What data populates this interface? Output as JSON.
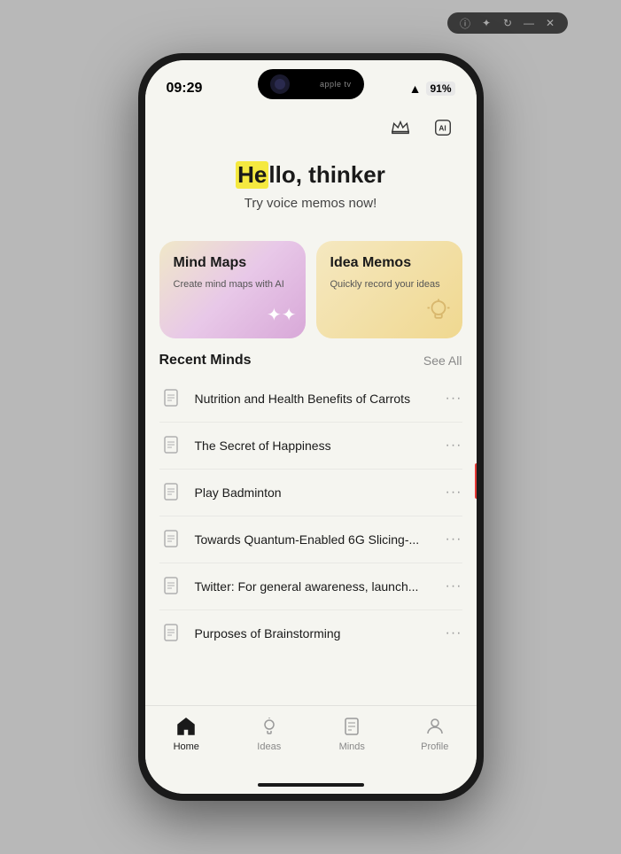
{
  "browser": {
    "icons": [
      "info",
      "star",
      "refresh",
      "minimize",
      "close"
    ]
  },
  "status_bar": {
    "time": "09:29",
    "wifi": "WiFi",
    "battery": "91%",
    "dynamic_island_label": "apple tv"
  },
  "header": {
    "crown_icon": "crown",
    "ai_icon": "AI"
  },
  "greeting": {
    "highlight": "He",
    "rest": "llo, thinker",
    "subtitle": "Try voice memos now!"
  },
  "cards": [
    {
      "id": "mind-maps",
      "title": "Mind Maps",
      "subtitle": "Create mind maps with AI",
      "icon": "✦"
    },
    {
      "id": "idea-memos",
      "title": "Idea Memos",
      "subtitle": "Quickly record your ideas",
      "icon": "💡"
    }
  ],
  "recent": {
    "title": "Recent Minds",
    "see_all": "See All",
    "items": [
      {
        "text": "Nutrition and Health Benefits of Carrots"
      },
      {
        "text": "The Secret of Happiness"
      },
      {
        "text": "Play Badminton"
      },
      {
        "text": "Towards Quantum-Enabled 6G Slicing-..."
      },
      {
        "text": "Twitter: For general awareness, launch..."
      },
      {
        "text": "Purposes of Brainstorming"
      }
    ]
  },
  "nav": [
    {
      "id": "home",
      "label": "Home",
      "active": true
    },
    {
      "id": "ideas",
      "label": "Ideas",
      "active": false
    },
    {
      "id": "minds",
      "label": "Minds",
      "active": false
    },
    {
      "id": "profile",
      "label": "Profile",
      "active": false
    }
  ]
}
